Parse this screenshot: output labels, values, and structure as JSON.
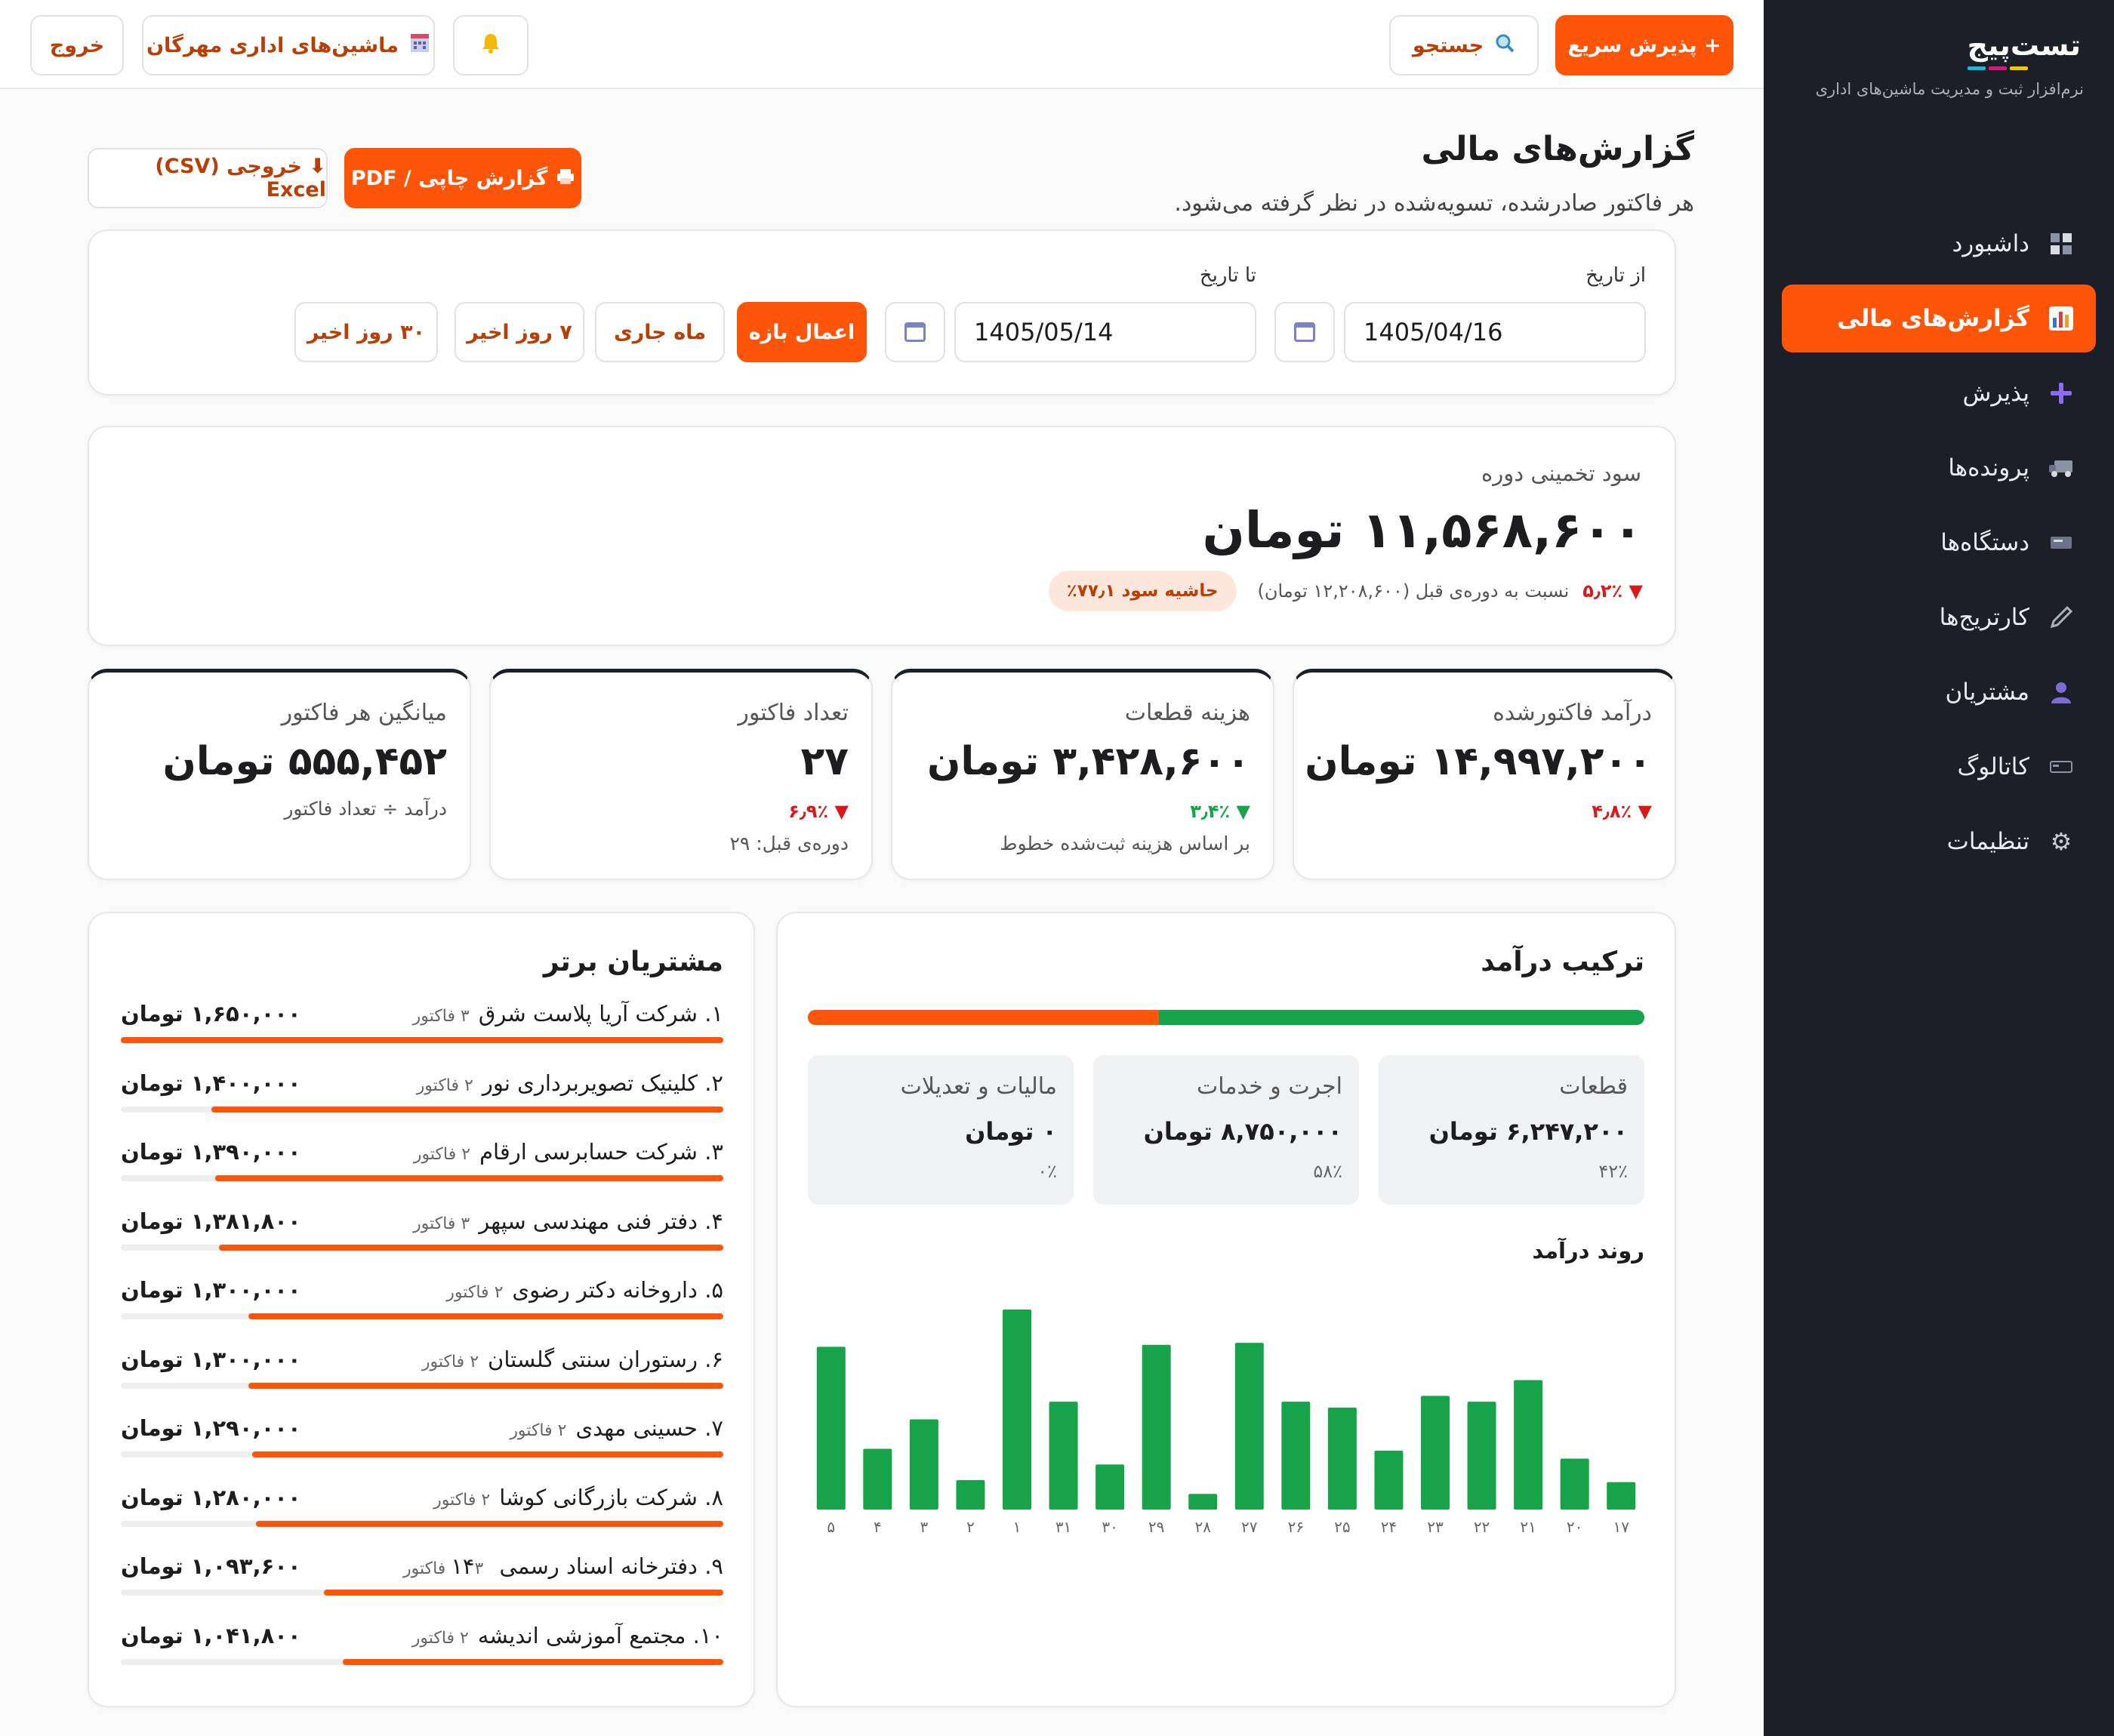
{
  "sidebar": {
    "logo_text": "تست‌پیج",
    "subtitle": "نرم‌افزار ثبت و مدیریت ماشین‌های اداری",
    "items": [
      {
        "label": "داشبورد",
        "icon": "dashboard-icon"
      },
      {
        "label": "گزارش‌های مالی",
        "icon": "chart-icon",
        "active": true
      },
      {
        "label": "پذیرش",
        "icon": "plus-icon"
      },
      {
        "label": "پرونده‌ها",
        "icon": "truck-icon"
      },
      {
        "label": "دستگاه‌ها",
        "icon": "device-icon"
      },
      {
        "label": "کارتریج‌ها",
        "icon": "pen-icon"
      },
      {
        "label": "مشتریان",
        "icon": "user-icon"
      },
      {
        "label": "کاتالوگ",
        "icon": "catalog-icon"
      },
      {
        "label": "تنظیمات",
        "icon": "gear-icon"
      }
    ]
  },
  "topbar": {
    "quick_reception": "+ پذیرش سریع",
    "search": "جستجو",
    "company": "ماشین‌های اداری مهرگان",
    "logout": "خروج"
  },
  "header": {
    "title": "گزارش‌های مالی",
    "subtitle": "هر فاکتور صادرشده، تسویه‌شده در نظر گرفته می‌شود.",
    "print_button": "گزارش چاپی / PDF",
    "export_button": "⬇ خروجی (CSV) Excel"
  },
  "filters": {
    "from_label": "از تاریخ",
    "to_label": "تا تاریخ",
    "from_value": "1405/04/16",
    "to_value": "1405/05/14",
    "apply": "اعمال بازه",
    "current_month": "ماه جاری",
    "last_7": "۷ روز اخیر",
    "last_30": "۳۰ روز اخیر"
  },
  "profit": {
    "label": "سود تخمینی دوره",
    "value": "۱۱,۵۶۸,۶۰۰ تومان",
    "delta": "▼ ۵٫۲٪",
    "compare": "نسبت به دوره‌ی قبل (۱۲,۲۰۸,۶۰۰ تومان)",
    "margin": "حاشیه سود ۷۷٫۱٪"
  },
  "kpis": [
    {
      "label": "درآمد فاکتورشده",
      "value": "۱۴,۹۹۷,۲۰۰ تومان",
      "delta": "▼ ۴٫۸٪",
      "trend": "down",
      "note": ""
    },
    {
      "label": "هزینه قطعات",
      "value": "۳,۴۲۸,۶۰۰ تومان",
      "delta": "▼ ۳٫۴٪",
      "trend": "up",
      "note": "بر اساس هزینه ثبت‌شده خطوط"
    },
    {
      "label": "تعداد فاکتور",
      "value": "۲۷",
      "delta": "▼ ۶٫۹٪",
      "trend": "down",
      "note": "دوره‌ی قبل: ۲۹"
    },
    {
      "label": "میانگین هر فاکتور",
      "value": "۵۵۵,۴۵۲ تومان",
      "delta": "",
      "trend": "",
      "note": "درآمد ÷ تعداد فاکتور"
    }
  ],
  "revenue_mix": {
    "title": "ترکیب درآمد",
    "bar": {
      "parts_share": 0.42,
      "parts_color": "#ff5508",
      "labor_share": 0.58,
      "labor_color": "#16a34a"
    },
    "cards": [
      {
        "label": "قطعات",
        "value": "۶,۲۴۷,۲۰۰ تومان",
        "pct": "۴۲٪"
      },
      {
        "label": "اجرت و خدمات",
        "value": "۸,۷۵۰,۰۰۰ تومان",
        "pct": "۵۸٪"
      },
      {
        "label": "مالیات و تعدیلات",
        "value": "۰ تومان",
        "pct": "۰٪"
      }
    ],
    "trend_title": "روند درآمد"
  },
  "chart_data": {
    "type": "bar",
    "color": "#16a34a",
    "categories": [
      "۱۷",
      "۲۰",
      "۲۱",
      "۲۲",
      "۲۳",
      "۲۴",
      "۲۵",
      "۲۶",
      "۲۷",
      "۲۸",
      "۲۹",
      "۳۰",
      "۳۱",
      "۱",
      "۲",
      "۳",
      "۴",
      "۵"
    ],
    "values": [
      14,
      26,
      66,
      55,
      58,
      30,
      52,
      55,
      85,
      8,
      84,
      23,
      55,
      102,
      15,
      46,
      31,
      83
    ]
  },
  "top_customers": {
    "title": "مشتریان برتر",
    "rows": [
      {
        "name": "۱. شرکت آریا پلاست شرق",
        "invoices": "۳ فاکتور",
        "amount": "۱,۶۵۰,۰۰۰ تومان",
        "share": 1.0
      },
      {
        "name": "۲. کلینیک تصویربرداری نور",
        "invoices": "۲ فاکتور",
        "amount": "۱,۴۰۰,۰۰۰ تومان",
        "share": 0.85
      },
      {
        "name": "۳. شرکت حسابرسی ارقام",
        "invoices": "۲ فاکتور",
        "amount": "۱,۳۹۰,۰۰۰ تومان",
        "share": 0.843
      },
      {
        "name": "۴. دفتر فنی مهندسی سپهر",
        "invoices": "۳ فاکتور",
        "amount": "۱,۳۸۱,۸۰۰ تومان",
        "share": 0.837
      },
      {
        "name": "۵. داروخانه دکتر رضوی",
        "invoices": "۲ فاکتور",
        "amount": "۱,۳۰۰,۰۰۰ تومان",
        "share": 0.788
      },
      {
        "name": "۶. رستوران سنتی گلستان",
        "invoices": "۲ فاکتور",
        "amount": "۱,۳۰۰,۰۰۰ تومان",
        "share": 0.788
      },
      {
        "name": "۷. حسینی مهدی",
        "invoices": "۲ فاکتور",
        "amount": "۱,۲۹۰,۰۰۰ تومان",
        "share": 0.782
      },
      {
        "name": "۸. شرکت بازرگانی کوشا",
        "invoices": "۲ فاکتور",
        "amount": "۱,۲۸۰,۰۰۰ تومان",
        "share": 0.776
      },
      {
        "name": "۹. دفترخانه اسناد رسمی ۱۴",
        "invoices": "۳ فاکتور",
        "amount": "۱,۰۹۳,۶۰۰ تومان",
        "share": 0.663
      },
      {
        "name": "۱۰. مجتمع آموزشی اندیشه",
        "invoices": "۲ فاکتور",
        "amount": "۱,۰۴۱,۸۰۰ تومان",
        "share": 0.631
      }
    ]
  }
}
